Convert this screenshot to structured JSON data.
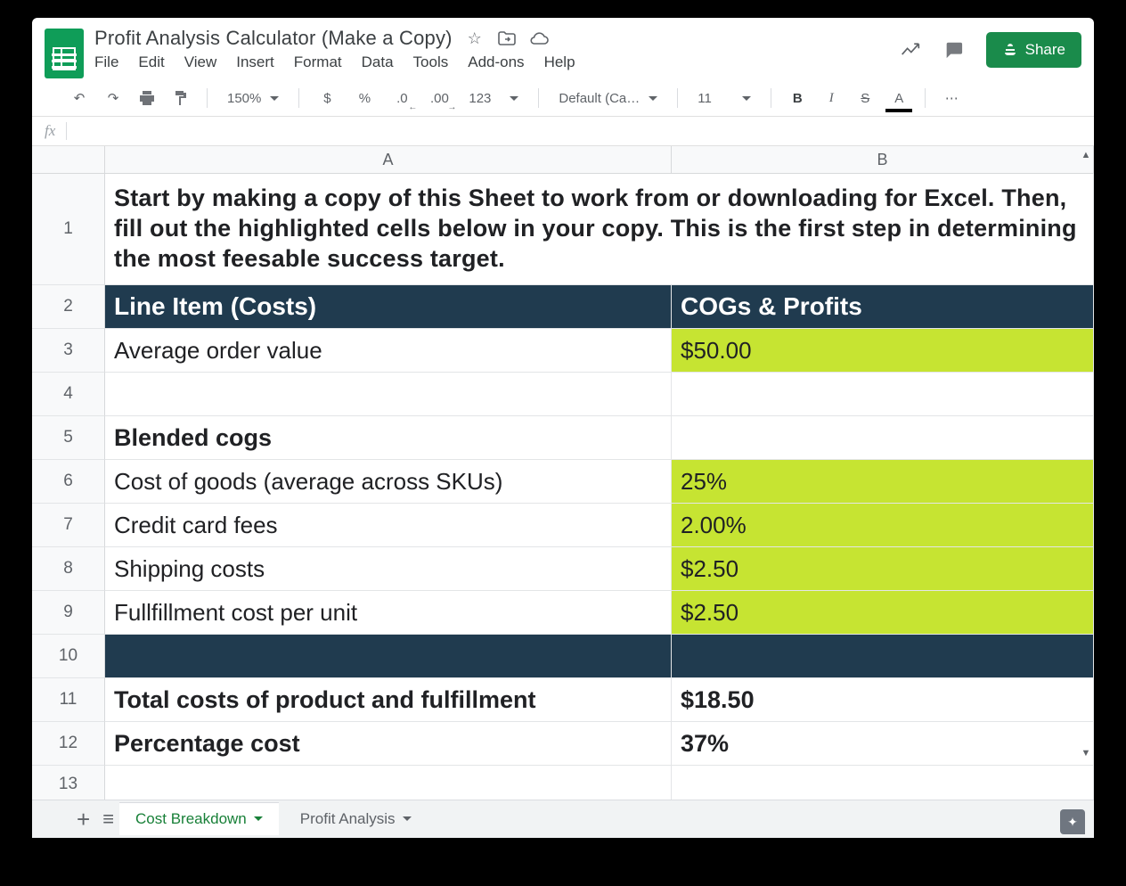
{
  "doc": {
    "title": "Profit Analysis Calculator (Make a Copy)"
  },
  "menubar": [
    "File",
    "Edit",
    "View",
    "Insert",
    "Format",
    "Data",
    "Tools",
    "Add-ons",
    "Help"
  ],
  "toolbar": {
    "zoom": "150%",
    "currency": "$",
    "percent": "%",
    "dec_dec": ".0",
    "inc_dec": ".00",
    "numfmt": "123",
    "font": "Default (Ca…",
    "fontsize": "11",
    "bold": "B",
    "italic": "I",
    "strike": "S",
    "textcolor": "A",
    "more": "⋯"
  },
  "share": "Share",
  "fx_label": "fx",
  "colA": "A",
  "colB": "B",
  "rows": {
    "1": {
      "n": "1",
      "a": "Start by making a copy of this Sheet to work from or downloading for Excel. Then, fill out the highlighted cells below in your copy. This is the first step in determining the most feesable success target."
    },
    "2": {
      "n": "2",
      "a": "Line Item (Costs)",
      "b": "COGs & Profits"
    },
    "3": {
      "n": "3",
      "a": "Average order value",
      "b": "$50.00"
    },
    "4": {
      "n": "4",
      "a": "",
      "b": ""
    },
    "5": {
      "n": "5",
      "a": "Blended cogs",
      "b": ""
    },
    "6": {
      "n": "6",
      "a": "Cost of goods (average across SKUs)",
      "b": "25%"
    },
    "7": {
      "n": "7",
      "a": "Credit card fees",
      "b": "2.00%"
    },
    "8": {
      "n": "8",
      "a": "Shipping costs",
      "b": "$2.50"
    },
    "9": {
      "n": "9",
      "a": "Fullfillment cost per unit",
      "b": "$2.50"
    },
    "10": {
      "n": "10",
      "a": "",
      "b": ""
    },
    "11": {
      "n": "11",
      "a": "Total costs of product and fulfillment",
      "b": "$18.50"
    },
    "12": {
      "n": "12",
      "a": "Percentage cost",
      "b": "37%"
    },
    "13": {
      "n": "13",
      "a": "",
      "b": ""
    }
  },
  "tabs": {
    "active": "Cost Breakdown",
    "other": "Profit Analysis"
  }
}
